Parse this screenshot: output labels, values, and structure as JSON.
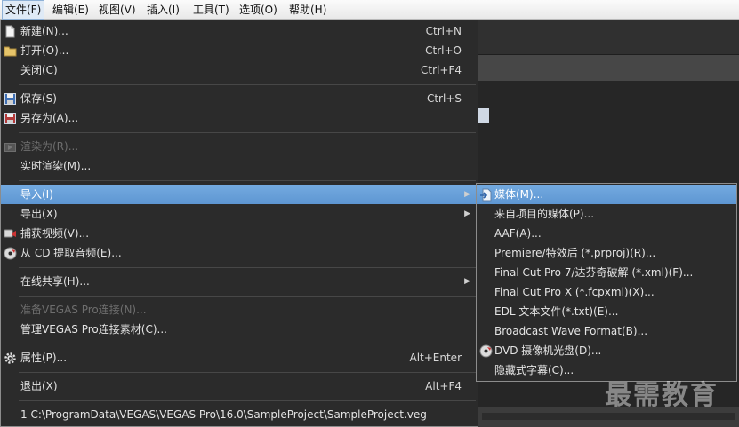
{
  "menubar": {
    "items": [
      {
        "label": "文件(F)"
      },
      {
        "label": "编辑(E)"
      },
      {
        "label": "视图(V)"
      },
      {
        "label": "插入(I)"
      },
      {
        "label": "工具(T)"
      },
      {
        "label": "选项(O)"
      },
      {
        "label": "帮助(H)"
      }
    ]
  },
  "file_menu": {
    "new": {
      "label": "新建(N)...",
      "shortcut": "Ctrl+N"
    },
    "open": {
      "label": "打开(O)...",
      "shortcut": "Ctrl+O"
    },
    "close": {
      "label": "关闭(C)",
      "shortcut": "Ctrl+F4"
    },
    "save": {
      "label": "保存(S)",
      "shortcut": "Ctrl+S"
    },
    "save_as": {
      "label": "另存为(A)..."
    },
    "render_as": {
      "label": "渲染为(R)..."
    },
    "realtime_render": {
      "label": "实时渲染(M)..."
    },
    "import": {
      "label": "导入(I)"
    },
    "export": {
      "label": "导出(X)"
    },
    "capture_video": {
      "label": "捕获视频(V)..."
    },
    "extract_cd": {
      "label": "从 CD 提取音频(E)..."
    },
    "share_online": {
      "label": "在线共享(H)..."
    },
    "prepare_connect": {
      "label": "准备VEGAS Pro连接(N)..."
    },
    "manage_connect": {
      "label": "管理VEGAS Pro连接素材(C)..."
    },
    "properties": {
      "label": "属性(P)...",
      "shortcut": "Alt+Enter"
    },
    "exit": {
      "label": "退出(X)",
      "shortcut": "Alt+F4"
    },
    "recent": {
      "label": "1 C:\\ProgramData\\VEGAS\\VEGAS Pro\\16.0\\SampleProject\\SampleProject.veg"
    }
  },
  "import_submenu": {
    "items": [
      {
        "label": "媒体(M)..."
      },
      {
        "label": "来自项目的媒体(P)..."
      },
      {
        "label": "AAF(A)..."
      },
      {
        "label": "Premiere/特效后 (*.prproj)(R)..."
      },
      {
        "label": "Final Cut Pro 7/达芬奇破解 (*.xml)(F)..."
      },
      {
        "label": "Final Cut Pro X (*.fcpxml)(X)..."
      },
      {
        "label": "EDL 文本文件(*.txt)(E)..."
      },
      {
        "label": "Broadcast Wave Format(B)..."
      },
      {
        "label": "DVD 摄像机光盘(D)..."
      },
      {
        "label": "隐藏式字幕(C)..."
      }
    ]
  },
  "watermark": "最需教育"
}
